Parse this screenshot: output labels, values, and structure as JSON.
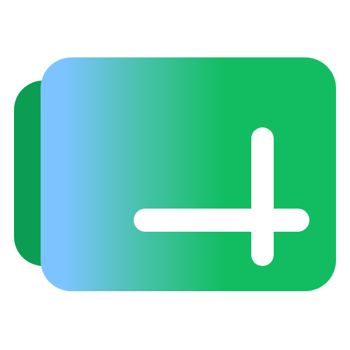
{
  "icon": {
    "name": "add-folder-icon",
    "colors": {
      "back_card": "#0b9e52",
      "front_card": "#12bd62",
      "gradient_light": "#7cc4ff",
      "plus_sign": "#ffffff",
      "background": "#ffffff"
    }
  }
}
